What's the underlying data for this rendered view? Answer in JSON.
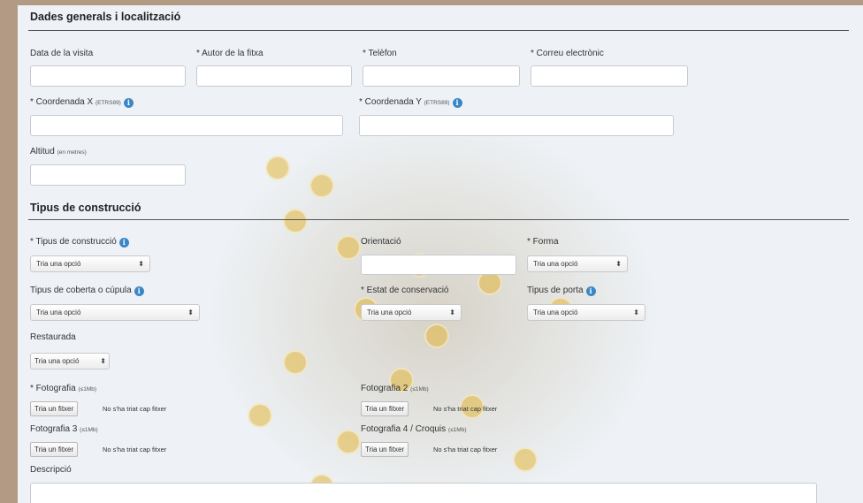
{
  "sections": {
    "general": "Dades generals i localització",
    "construction": "Tipus de construcció"
  },
  "fields": {
    "visit_date": "Data de la visita",
    "author": "* Autor de la fitxa",
    "phone": "* Telèfon",
    "email": "* Correu electrònic",
    "coord_x": "* Coordenada X",
    "coord_x_unit": "(ETRS89)",
    "coord_y": "* Coordenada Y",
    "coord_y_unit": "(ETRS89)",
    "altitude": "Altitud",
    "altitude_unit": "(en metres)",
    "construction_type": "* Tipus de construcció",
    "orientation": "Orientació",
    "shape": "* Forma",
    "roof_type": "Tipus de coberta o cúpula",
    "conservation": "* Estat de conservació",
    "door_type": "Tipus de porta",
    "restored": "Restaurada",
    "photo1": "* Fotografia",
    "photo2": "Fotografia 2",
    "photo3": "Fotografia 3",
    "photo4": "Fotografia 4 / Croquis",
    "photo_size": "(≤1Mb)",
    "description": "Descripció"
  },
  "select_placeholder": "Tria una opció",
  "file": {
    "button": "Tria un fitxer",
    "none": "No s'ha triat cap fitxer"
  },
  "icons": {
    "info": "info-circle-icon",
    "select_arrow": "up-down-arrows-icon"
  },
  "colors": {
    "accent": "#3b86c6",
    "background": "#b29a85",
    "panel": "#eef2f6"
  }
}
